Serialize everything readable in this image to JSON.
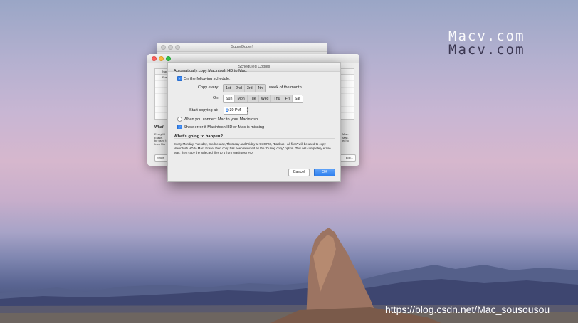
{
  "watermark": {
    "line1": "Macv.com",
    "line2": "Macv.com",
    "url": "https://blog.csdn.net/Mac_sousousou"
  },
  "back_window_1": {
    "title": "SuperDuper!"
  },
  "back_window_2": {
    "col_name": "Nar",
    "row1": "Eve",
    "left_heading": "What'",
    "left_text": [
      "Every M",
      "Erase,",
      "be used t",
      "from Ma"
    ],
    "right_text": [
      "Mac.",
      "Mac,",
      "ed to"
    ],
    "show_button": "Show",
    "edit_button": "Edit..."
  },
  "dialog": {
    "title": "Scheduled Copies",
    "intro": "Automatically copy Macintosh HD to Mac:",
    "on_schedule_label": "On the following schedule:",
    "copy_every_label": "Copy every:",
    "weeks": [
      "1st",
      "2nd",
      "3rd",
      "4th"
    ],
    "weeks_selected": [
      true,
      true,
      true,
      true
    ],
    "weeks_suffix": "week of the month",
    "on_label": "On:",
    "days": [
      "Sun",
      "Mon",
      "Tue",
      "Wed",
      "Thu",
      "Fri",
      "Sat"
    ],
    "days_selected": [
      false,
      true,
      true,
      true,
      true,
      true,
      false
    ],
    "start_label": "Start copying at:",
    "time_hour": "9",
    "time_rest": ":30 PM",
    "connect_label": "When you connect Mac to your Macintosh",
    "show_error_label": "Show error if Macintosh HD or Mac is missing",
    "whats_heading": "What's going to happen?",
    "whats_text": "Every Monday, Tuesday, Wednesday, Thursday and Friday at 9:30 PM, \"Backup - all files\" will be used to copy Macintosh HD to Mac. Erase, then copy has been selected as the \"During copy\" option. This will completely erase Mac, then copy the selected files to it from Macintosh HD.",
    "cancel": "Cancel",
    "ok": "OK"
  },
  "colors": {
    "accent": "#3a86ee"
  }
}
